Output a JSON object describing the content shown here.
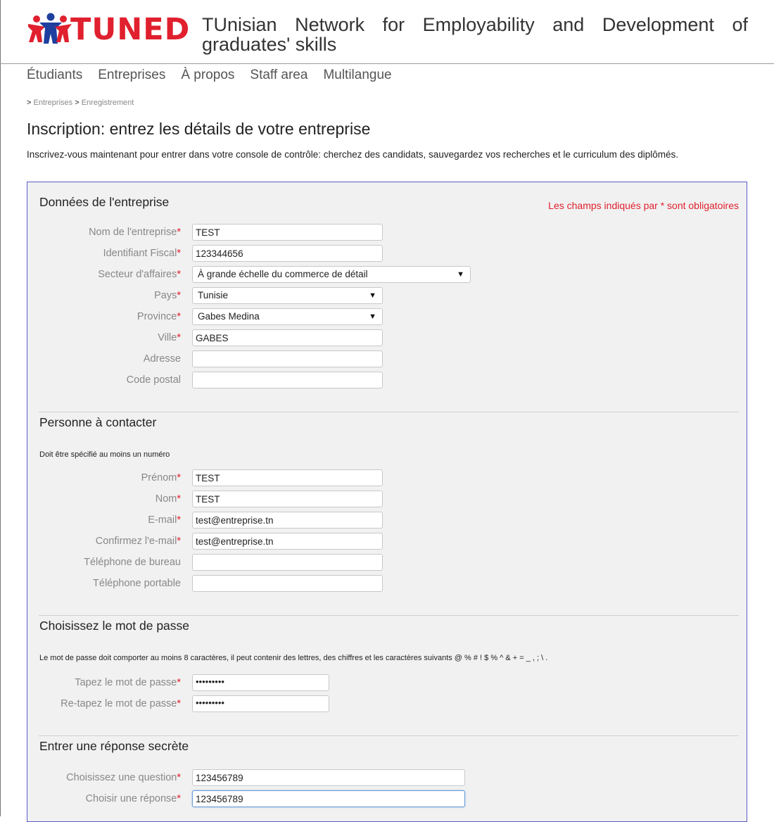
{
  "header": {
    "logo_text": "TUNED",
    "site_title": "TUnisian Network for Employability and Development of graduates' skills"
  },
  "nav": {
    "items": [
      "Étudiants",
      "Entreprises",
      "À propos",
      "Staff area",
      "Multilangue"
    ]
  },
  "breadcrumb": {
    "sep1": ">",
    "item1": "Entreprises",
    "sep2": ">",
    "item2": "Enregistrement"
  },
  "page": {
    "title": "Inscription: entrez les détails de votre entreprise",
    "intro": "Inscrivez-vous maintenant pour entrer dans votre console de contrôle: cherchez des candidats, sauvegardez vos recherches et le curriculum des diplômés."
  },
  "form": {
    "required_note": "Les champs indiqués par * sont obligatoires",
    "required_star": "*",
    "company": {
      "title": "Données de l'entreprise",
      "fields": [
        {
          "label": "Nom de l'entreprise",
          "required": true,
          "value": ""
        },
        {
          "label": "Identifiant Fiscal",
          "required": true,
          "value": ""
        },
        {
          "label": "Secteur d'affaires",
          "required": true,
          "value": "À grande échelle du commerce de détail"
        },
        {
          "label": "Pays",
          "required": true,
          "value": "Tunisie"
        },
        {
          "label": "Province",
          "required": true,
          "value": "Gabes Medina"
        },
        {
          "label": "Ville",
          "required": true,
          "value": "GABES"
        },
        {
          "label": "Adresse",
          "required": false,
          "value": ""
        },
        {
          "label": "Code postal",
          "required": false,
          "value": ""
        }
      ],
      "input_values": [
        "TEST",
        "123344656"
      ]
    },
    "contact": {
      "title": "Personne à contacter",
      "hint": "Doit être spécifié au moins un numéro",
      "fields": [
        {
          "label": "Prénom",
          "required": true,
          "value": "TEST"
        },
        {
          "label": "Nom",
          "required": true,
          "value": "TEST"
        },
        {
          "label": "E-mail",
          "required": true,
          "value": "test@entreprise.tn"
        },
        {
          "label": "Confirmez l'e-mail",
          "required": true,
          "value": "test@entreprise.tn"
        },
        {
          "label": "Téléphone de bureau",
          "required": false,
          "value": ""
        },
        {
          "label": "Téléphone portable",
          "required": false,
          "value": ""
        }
      ]
    },
    "password": {
      "title": "Choisissez le mot de passe",
      "hint": "Le mot de passe doit comporter au moins 8 caractères, il peut contenir des lettres, des chiffres et les caractères suivants @ % # ! $ % ^ & + = _ , ; \\ .",
      "fields": [
        {
          "label": "Tapez le mot de passe",
          "required": true,
          "value": "•••••••••"
        },
        {
          "label": "Re-tapez le mot de passe",
          "required": true,
          "value": "•••••••••"
        }
      ]
    },
    "secret": {
      "title": "Entrer une réponse secrète",
      "fields": [
        {
          "label": "Choisissez une question",
          "required": true,
          "value": "123456789"
        },
        {
          "label": "Choisir une réponse",
          "required": true,
          "value": "123456789"
        }
      ]
    }
  },
  "colors": {
    "brand_red": "#e0202e",
    "form_border": "#5a5ac8",
    "form_bg": "#f1f1f1"
  },
  "icons": {
    "logo": "people-figures-icon",
    "dropdown": "dropdown-arrow-icon"
  }
}
